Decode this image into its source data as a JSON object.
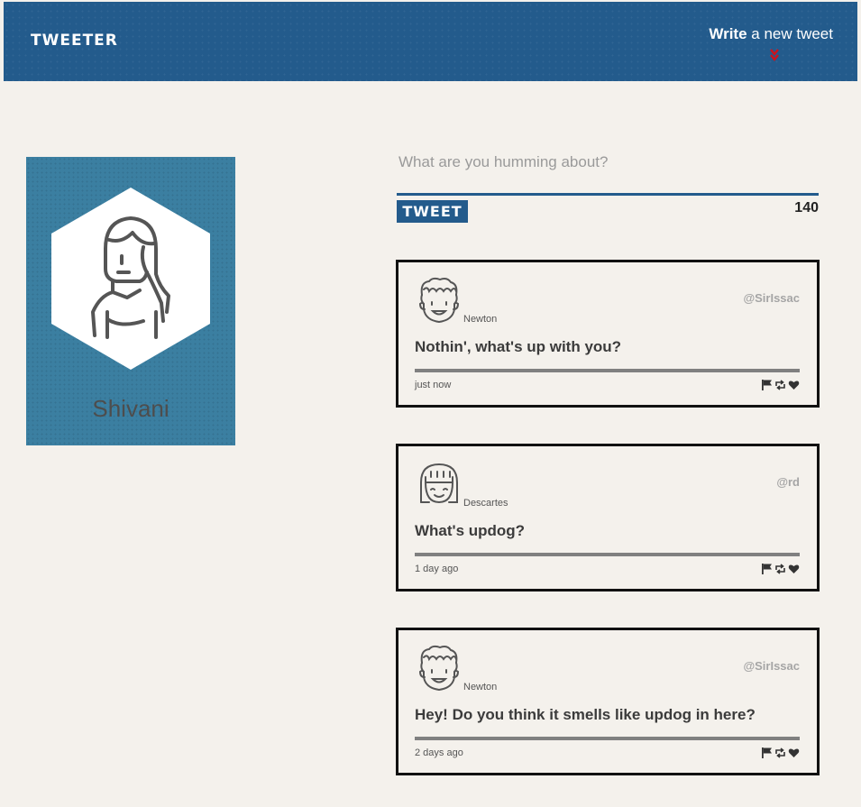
{
  "nav": {
    "logo": "TWEETER",
    "compose_bold": "Write",
    "compose_rest": " a new tweet"
  },
  "profile": {
    "name": "Shivani",
    "icon": "woman-avatar-icon"
  },
  "compose": {
    "placeholder": "What are you humming about?",
    "button_label": "TWEET",
    "char_count": "140"
  },
  "tweets": [
    {
      "avatar": "curly-hair-man-avatar-icon",
      "name": "Newton",
      "handle": "@SirIssac",
      "content": "Nothin', what's up with you?",
      "time": "just now"
    },
    {
      "avatar": "bob-hair-girl-avatar-icon",
      "name": "Descartes",
      "handle": "@rd",
      "content": "What's updog?",
      "time": "1 day ago"
    },
    {
      "avatar": "curly-hair-man-avatar-icon",
      "name": "Newton",
      "handle": "@SirIssac",
      "content": "Hey! Do you think it smells like updog in here?",
      "time": "2 days ago"
    }
  ],
  "colors": {
    "brand": "#235b8c",
    "profile_bg": "#3b7fa1",
    "page_bg": "#f4f1ec",
    "chevron": "#d0121b"
  }
}
